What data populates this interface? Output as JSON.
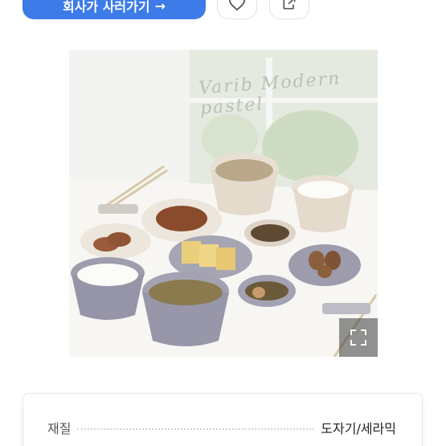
{
  "top_bar": {
    "cta_label": "회사가 사러가기",
    "cta_arrow": "→",
    "like_icon": "heart-icon",
    "share_icon": "share-icon"
  },
  "photo": {
    "caption": "Varib Modern pastel",
    "expand_icon": "expand-icon"
  },
  "info": {
    "rows": [
      {
        "label": "재질",
        "value": "도자기/세라믹"
      }
    ]
  }
}
